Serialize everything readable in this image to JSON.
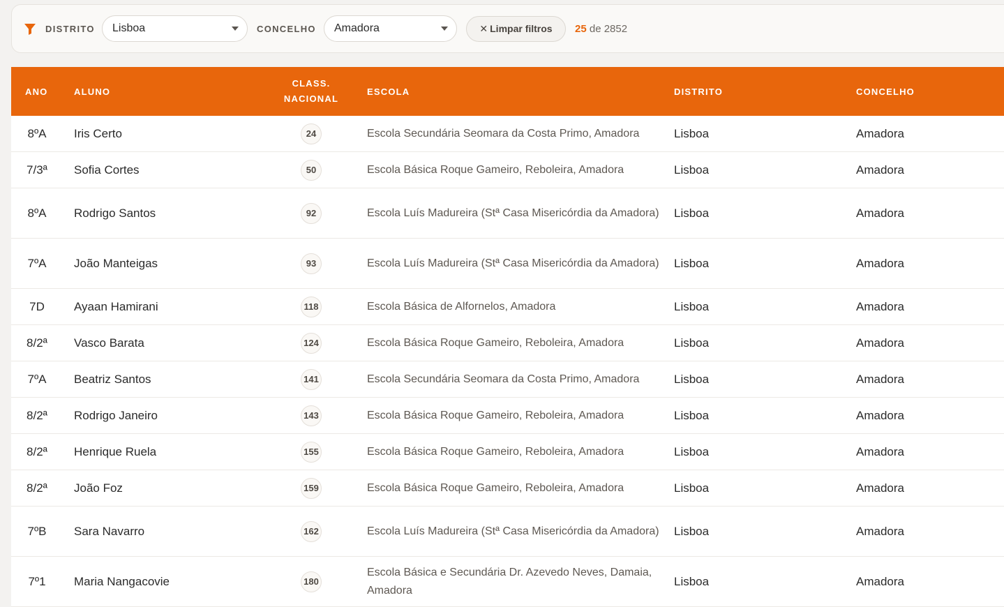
{
  "filters": {
    "distrito_label": "DISTRITO",
    "distrito_value": "Lisboa",
    "concelho_label": "CONCELHO",
    "concelho_value": "Amadora",
    "clear_label": "Limpar filtros",
    "count_shown": "25",
    "count_suffix": "de 2852"
  },
  "colors": {
    "accent": "#e8660c"
  },
  "table": {
    "headers": {
      "ano": "ANO",
      "aluno": "ALUNO",
      "rank_line1": "CLASS.",
      "rank_line2": "NACIONAL",
      "escola": "ESCOLA",
      "distrito": "DISTRITO",
      "concelho": "CONCELHO"
    },
    "rows": [
      {
        "ano": "8ºA",
        "aluno": "Iris Certo",
        "rank": "24",
        "escola": "Escola Secundária Seomara da Costa Primo, Amadora",
        "distrito": "Lisboa",
        "concelho": "Amadora"
      },
      {
        "ano": "7/3ª",
        "aluno": "Sofia Cortes",
        "rank": "50",
        "escola": "Escola Básica Roque Gameiro, Reboleira, Amadora",
        "distrito": "Lisboa",
        "concelho": "Amadora"
      },
      {
        "ano": "8ºA",
        "aluno": "Rodrigo Santos",
        "rank": "92",
        "escola": "Escola Luís Madureira (Stª Casa Misericórdia da Amadora)",
        "distrito": "Lisboa",
        "concelho": "Amadora"
      },
      {
        "ano": "7ºA",
        "aluno": "João Manteigas",
        "rank": "93",
        "escola": "Escola Luís Madureira (Stª Casa Misericórdia da Amadora)",
        "distrito": "Lisboa",
        "concelho": "Amadora"
      },
      {
        "ano": "7D",
        "aluno": "Ayaan Hamirani",
        "rank": "118",
        "escola": "Escola Básica de Alfornelos, Amadora",
        "distrito": "Lisboa",
        "concelho": "Amadora"
      },
      {
        "ano": "8/2ª",
        "aluno": "Vasco Barata",
        "rank": "124",
        "escola": "Escola Básica Roque Gameiro, Reboleira, Amadora",
        "distrito": "Lisboa",
        "concelho": "Amadora"
      },
      {
        "ano": "7ºA",
        "aluno": "Beatriz Santos",
        "rank": "141",
        "escola": "Escola Secundária Seomara da Costa Primo, Amadora",
        "distrito": "Lisboa",
        "concelho": "Amadora"
      },
      {
        "ano": "8/2ª",
        "aluno": "Rodrigo Janeiro",
        "rank": "143",
        "escola": "Escola Básica Roque Gameiro, Reboleira, Amadora",
        "distrito": "Lisboa",
        "concelho": "Amadora"
      },
      {
        "ano": "8/2ª",
        "aluno": "Henrique Ruela",
        "rank": "155",
        "escola": "Escola Básica Roque Gameiro, Reboleira, Amadora",
        "distrito": "Lisboa",
        "concelho": "Amadora"
      },
      {
        "ano": "8/2ª",
        "aluno": "João Foz",
        "rank": "159",
        "escola": "Escola Básica Roque Gameiro, Reboleira, Amadora",
        "distrito": "Lisboa",
        "concelho": "Amadora"
      },
      {
        "ano": "7ºB",
        "aluno": "Sara Navarro",
        "rank": "162",
        "escola": "Escola Luís Madureira (Stª Casa Misericórdia da Amadora)",
        "distrito": "Lisboa",
        "concelho": "Amadora"
      },
      {
        "ano": "7º1",
        "aluno": "Maria Nangacovie",
        "rank": "180",
        "escola": "Escola Básica e Secundária Dr. Azevedo Neves, Damaia, Amadora",
        "distrito": "Lisboa",
        "concelho": "Amadora"
      }
    ]
  }
}
